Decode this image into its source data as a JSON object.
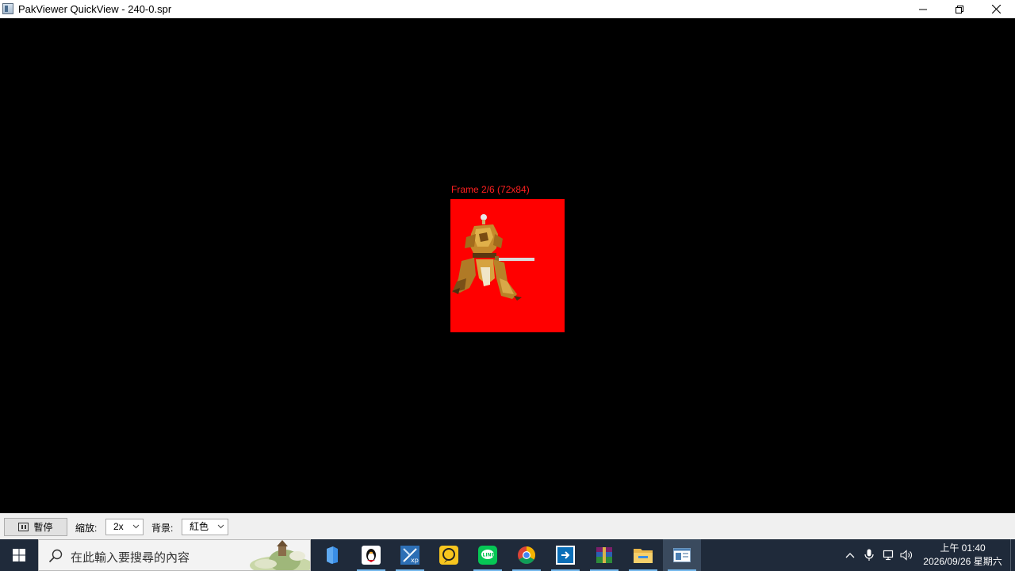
{
  "window": {
    "title": "PakViewer QuickView - 240-0.spr",
    "icon": "app-window-icon",
    "controls": [
      "minimize-icon",
      "restore-icon",
      "close-icon"
    ]
  },
  "viewer": {
    "frame_label": "Frame 2/6 (72x84)",
    "background_color": "#ff0000"
  },
  "controls": {
    "pause_label": "暫停",
    "zoom_label": "縮放:",
    "zoom_value": "2x",
    "background_label": "背景:",
    "background_value": "紅色"
  },
  "taskbar": {
    "search_placeholder": "在此輸入要搜尋的內容",
    "apps": [
      "file-icon",
      "qq-penguin-icon",
      "xp-icon",
      "chat-icon",
      "line-icon",
      "chrome-icon",
      "remote-icon",
      "winrar-icon",
      "folder-icon",
      "pakviewer-icon"
    ],
    "clock_time": "上午 01:40",
    "clock_date": "2026/09/26 星期六"
  }
}
